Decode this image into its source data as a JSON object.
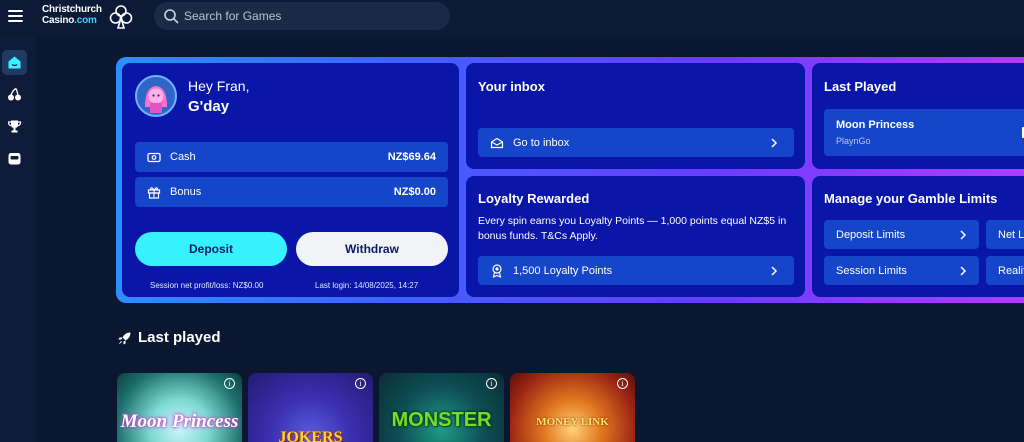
{
  "brand": {
    "line1": "Christchurch",
    "line2a": "Casino",
    "line2b": ".com"
  },
  "search": {
    "placeholder": "Search for Games"
  },
  "sidebar": {
    "items": [
      {
        "icon": "home-icon",
        "active": true
      },
      {
        "icon": "cherries-icon",
        "active": false
      },
      {
        "icon": "trophy-icon",
        "active": false
      },
      {
        "icon": "slot-machine-icon",
        "active": false
      }
    ]
  },
  "user": {
    "greeting": "Hey Fran,",
    "salutation": "G'day",
    "cash_label": "Cash",
    "cash_value": "NZ$69.64",
    "bonus_label": "Bonus",
    "bonus_value": "NZ$0.00",
    "deposit_label": "Deposit",
    "withdraw_label": "Withdraw",
    "session": "Session net profit/loss: NZ$0.00",
    "last_login": "Last login: 14/08/2025, 14:27"
  },
  "inbox": {
    "title": "Your inbox",
    "link": "Go to inbox"
  },
  "loyalty": {
    "title": "Loyalty Rewarded",
    "description": "Every spin earns you Loyalty Points — 1,000 points equal NZ$5 in bonus funds. T&Cs Apply.",
    "points": "1,500 Loyalty Points"
  },
  "last_played_card": {
    "title": "Last Played",
    "game": "Moon Princess",
    "provider": "PlaynGo"
  },
  "gamble": {
    "title": "Manage your Gamble Limits",
    "deposit_limits": "Deposit Limits",
    "net_limits": "Net L",
    "session_limits": "Session Limits",
    "reality": "Realit"
  },
  "section": {
    "title": "Last played"
  },
  "tiles": [
    {
      "name": "Moon Princess",
      "art_text": "Moon Princess"
    },
    {
      "name": "Jokers",
      "art_text": "JOKERS"
    },
    {
      "name": "Monster",
      "art_text": "MONSTER"
    },
    {
      "name": "Money Link",
      "art_text": "MONEY LINK"
    }
  ],
  "colors": {
    "accent_cyan": "#36f2ff",
    "card_bg": "#0a16a8",
    "row_bg": "#1545c8",
    "page_bg": "#0b1730"
  }
}
